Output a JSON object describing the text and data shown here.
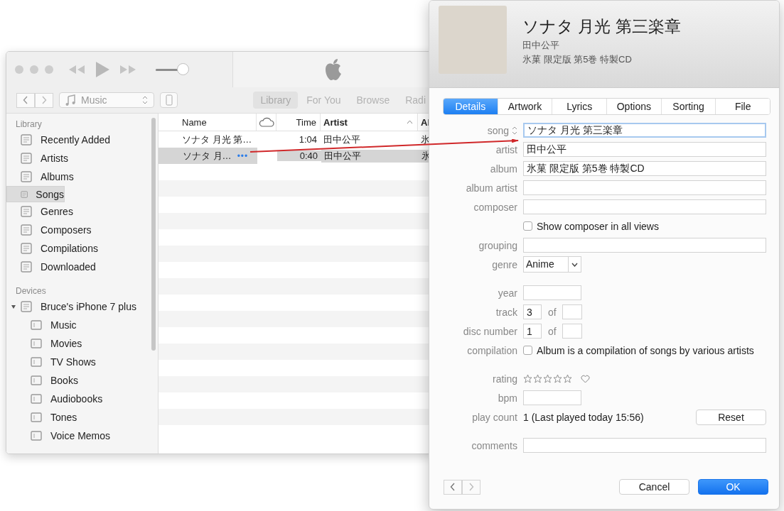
{
  "player": {
    "volume": {
      "level": 0.85
    },
    "source": "Music",
    "nav_tabs": [
      {
        "label": "Library",
        "selected": true
      },
      {
        "label": "For You",
        "selected": false
      },
      {
        "label": "Browse",
        "selected": false
      },
      {
        "label": "Radi",
        "selected": false
      }
    ]
  },
  "sidebar": {
    "sections": [
      {
        "title": "Library",
        "items": [
          {
            "label": "Recently Added",
            "selected": false
          },
          {
            "label": "Artists",
            "selected": false
          },
          {
            "label": "Albums",
            "selected": false
          },
          {
            "label": "Songs",
            "selected": true
          },
          {
            "label": "Genres",
            "selected": false
          },
          {
            "label": "Composers",
            "selected": false
          },
          {
            "label": "Compilations",
            "selected": false
          },
          {
            "label": "Downloaded",
            "selected": false
          }
        ]
      },
      {
        "title": "Devices",
        "items": [
          {
            "label": "Bruce's iPhone 7 plus",
            "selected": false,
            "expanded": true,
            "children": [
              {
                "label": "Music",
                "selected": false
              },
              {
                "label": "Movies",
                "selected": false
              },
              {
                "label": "TV Shows",
                "selected": false
              },
              {
                "label": "Books",
                "selected": false
              },
              {
                "label": "Audiobooks",
                "selected": false
              },
              {
                "label": "Tones",
                "selected": false
              },
              {
                "label": "Voice Memos",
                "selected": false
              }
            ]
          }
        ]
      }
    ]
  },
  "table": {
    "columns": [
      "Name",
      "Time",
      "Artist",
      "Al"
    ],
    "rows": [
      {
        "name": "ソナタ 月光 第…",
        "time": "1:04",
        "artist": "田中公平",
        "column_4": "氷",
        "selected": false
      },
      {
        "name": "ソナタ 月…",
        "time": "0:40",
        "artist": "田中公平",
        "column_4": "氷",
        "selected": true,
        "more": "•••"
      }
    ]
  },
  "info": {
    "title": "ソナタ 月光 第三楽章",
    "artist": "田中公平",
    "album": "氷菓 限定版 第5巻 特製CD",
    "tabs": [
      {
        "label": "Details",
        "selected": true
      },
      {
        "label": "Artwork",
        "selected": false
      },
      {
        "label": "Lyrics",
        "selected": false
      },
      {
        "label": "Options",
        "selected": false
      },
      {
        "label": "Sorting",
        "selected": false
      },
      {
        "label": "File",
        "selected": false
      }
    ],
    "fields": [
      {
        "kind": "text",
        "label": "song",
        "value": "ソナタ 月光 第三楽章",
        "focused": true,
        "sortable": true
      },
      {
        "kind": "text",
        "label": "artist",
        "value": "田中公平",
        "focused": false
      },
      {
        "kind": "text",
        "label": "album",
        "value": "氷菓 限定版 第5巻 特製CD",
        "focused": false
      },
      {
        "kind": "text",
        "label": "album artist",
        "focused": false
      },
      {
        "kind": "text",
        "label": "composer",
        "focused": false
      },
      {
        "kind": "checkbox",
        "text": "Show composer in all views",
        "checked": false
      },
      {
        "kind": "text",
        "label": "grouping",
        "focused": false
      },
      {
        "kind": "select",
        "label": "genre",
        "value": "Anime"
      },
      {
        "kind": "short",
        "label": "year"
      },
      {
        "kind": "pair",
        "label": "track",
        "value": "3",
        "of": "of"
      },
      {
        "kind": "pair",
        "label": "disc number",
        "value": "1",
        "of": "of"
      },
      {
        "kind": "checkbox",
        "label": "compilation",
        "text": "Album is a compilation of songs by various artists",
        "checked": false
      },
      {
        "kind": "rating",
        "label": "rating",
        "stars": 0,
        "loved": false
      },
      {
        "kind": "short",
        "label": "bpm"
      },
      {
        "kind": "readout",
        "label": "play count",
        "value": "1 (Last played today 15:56)",
        "button": "Reset"
      },
      {
        "kind": "text",
        "label": "comments",
        "focused": false
      }
    ],
    "buttons": [
      {
        "label": "Cancel",
        "primary": false
      },
      {
        "label": "OK",
        "primary": true
      }
    ]
  }
}
